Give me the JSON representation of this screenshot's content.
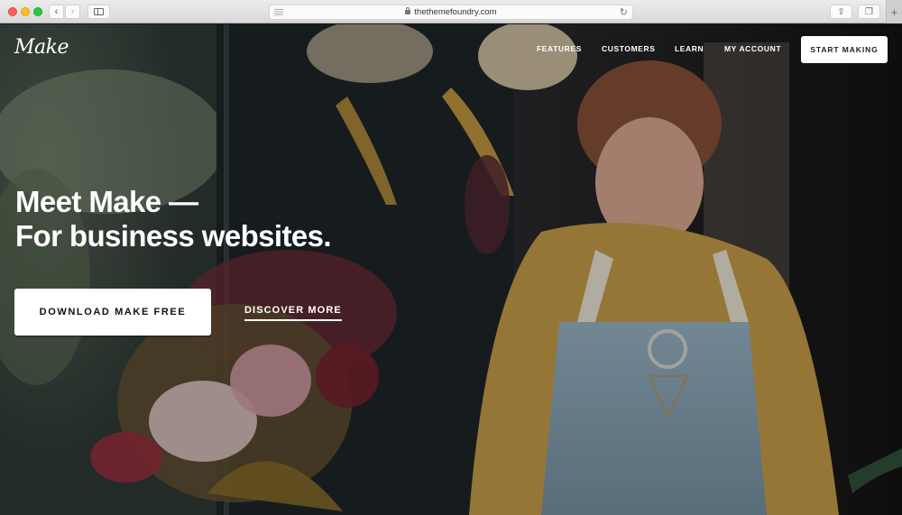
{
  "browser": {
    "url": "thethemefoundry.com",
    "back_glyph": "‹",
    "forward_glyph": "›",
    "reload_glyph": "↻",
    "share_glyph": "⇪",
    "tabs_glyph": "❐",
    "new_tab_glyph": "+",
    "icons": [
      "close-window",
      "minimize-window",
      "maximize-window",
      "back",
      "forward",
      "sidebar",
      "reader",
      "lock",
      "reload",
      "share",
      "tabs-overview",
      "new-tab"
    ]
  },
  "site": {
    "logo": "Make",
    "nav": [
      {
        "label": "FEATURES"
      },
      {
        "label": "CUSTOMERS"
      },
      {
        "label": "LEARN"
      },
      {
        "label": "MY ACCOUNT"
      }
    ],
    "nav_cta": "START MAKING"
  },
  "hero": {
    "headline_line1": "Meet Make —",
    "headline_line2": "For business websites.",
    "primary_button": "DOWNLOAD MAKE FREE",
    "secondary_link": "DISCOVER MORE",
    "image_description": "Woman in yellow blouse and light blue apron beside floral arrangement with pink roses and golden ferns"
  },
  "colors": {
    "nav_cta_bg": "#ffffff",
    "text_on_hero": "#ffffff",
    "button_text": "#111111"
  }
}
